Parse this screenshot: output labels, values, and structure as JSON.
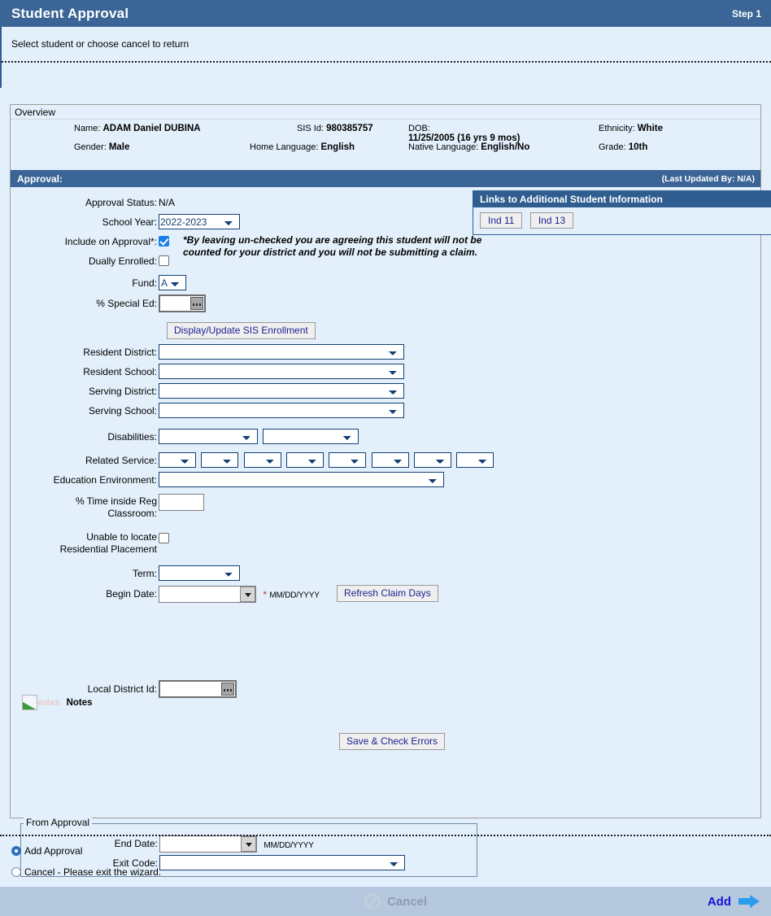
{
  "titlebar": {
    "title": "Student Approval",
    "step": "Step 1"
  },
  "instruction": "Select student or choose cancel to return",
  "overview": {
    "legend": "Overview",
    "fields": [
      {
        "label": "Name:",
        "value": "ADAM Daniel DUBINA"
      },
      {
        "label": "Gender:",
        "value": "Male"
      },
      {
        "label": "SIS Id:",
        "value": "980385757"
      },
      {
        "label": "Home Language:",
        "value": "English"
      },
      {
        "label": "DOB:",
        "value": "11/25/2005 (16 yrs 9 mos)"
      },
      {
        "label": "Native Language:",
        "value": "English/No"
      },
      {
        "label": "Ethnicity:",
        "value": "White"
      },
      {
        "label": "Grade:",
        "value": "10th"
      }
    ]
  },
  "approval": {
    "header": "Approval:",
    "last_updated": "(Last Updated By: N/A)",
    "approval_status_label": "Approval Status:",
    "approval_status_value": "N/A",
    "school_year_label": "School Year:",
    "school_year_value": "2022-2023",
    "include_label": "Include on Approval*:",
    "include_checked": true,
    "include_note": "*By leaving un-checked you are agreeing this student will not be counted for your district and you will not be submitting a claim.",
    "dually_label": "Dually Enrolled:",
    "dually_checked": false,
    "fund_label": "Fund:",
    "fund_value": "A",
    "pct_special_ed_label": "% Special Ed:",
    "pct_special_ed_value": "",
    "sis_enrollment_button": "Display/Update SIS Enrollment",
    "resident_district_label": "Resident District:",
    "resident_district_value": "",
    "resident_school_label": "Resident School:",
    "resident_school_value": "",
    "serving_district_label": "Serving District:",
    "serving_district_value": "",
    "serving_school_label": "Serving School:",
    "serving_school_value": "",
    "disabilities_label": "Disabilities:",
    "disabilities_values": [
      "",
      ""
    ],
    "related_service_label": "Related Service:",
    "related_service_values": [
      "",
      "",
      "",
      "",
      "",
      "",
      "",
      ""
    ],
    "education_environment_label": "Education Environment:",
    "education_environment_value": "",
    "pct_time_label": "% Time inside Reg Classroom:",
    "pct_time_value": "",
    "unable_locate_label": "Unable to locate Residential Placement",
    "unable_locate_checked": false,
    "term_label": "Term:",
    "term_value": "",
    "begin_date_label": "Begin Date:",
    "begin_date_value": "",
    "begin_date_required_mark": "*",
    "begin_date_format": "MM/DD/YYYY",
    "refresh_claim_days_button": "Refresh Claim Days",
    "from_approval_legend": "From Approval",
    "end_date_label": "End Date:",
    "end_date_value": "",
    "end_date_format": "MM/DD/YYYY",
    "exit_code_label": "Exit Code:",
    "exit_code_value": "",
    "local_district_id_label": "Local District Id:",
    "local_district_id_value": "",
    "notes_icon_alt": "Notes",
    "notes_label": "Notes",
    "save_button": "Save & Check Errors"
  },
  "links_box": {
    "header": "Links to Additional Student Information",
    "buttons": [
      "Ind 11",
      "Ind 13"
    ]
  },
  "choices": [
    {
      "label": "Add Approval",
      "selected": true
    },
    {
      "label": "Cancel - Please exit the wizard.",
      "selected": false
    }
  ],
  "footer": {
    "cancel": "Cancel",
    "add": "Add"
  },
  "colors": {
    "header_blue": "#3a6596",
    "page_bg": "#e3f0fb",
    "footer_bg": "#b6c8de",
    "accent_link": "#1414d8",
    "arrow_blue": "#2b9cf0",
    "required_star": "#c0392b"
  }
}
